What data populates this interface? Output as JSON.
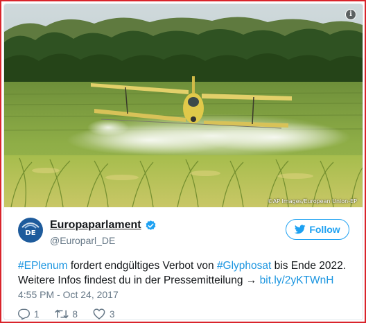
{
  "photo": {
    "credit": "©AP Images/European Union-EP",
    "info_icon": "info-icon"
  },
  "account": {
    "name": "Europaparlament",
    "handle": "@Europarl_DE",
    "avatar_text": "DE",
    "verified_icon": "verified-badge-icon"
  },
  "follow_button": {
    "label": "Follow",
    "icon": "twitter-bird-icon"
  },
  "tweet": {
    "hashtag1": "#EPlenum",
    "text1": " fordert endgültiges Verbot von ",
    "hashtag2": "#Glyphosat",
    "text2": " bis Ende 2022.",
    "line2": "Weitere Infos findest du in der Pressemitteilung → ",
    "link": "bit.ly/2yKTWnH",
    "timestamp": "4:55 PM - Oct 24, 2017"
  },
  "actions": {
    "replies": "1",
    "retweets": "8",
    "likes": "3"
  },
  "colors": {
    "frame_border": "#d9242b",
    "accent": "#1da1f2",
    "link": "#1b95e0",
    "muted": "#657786"
  }
}
